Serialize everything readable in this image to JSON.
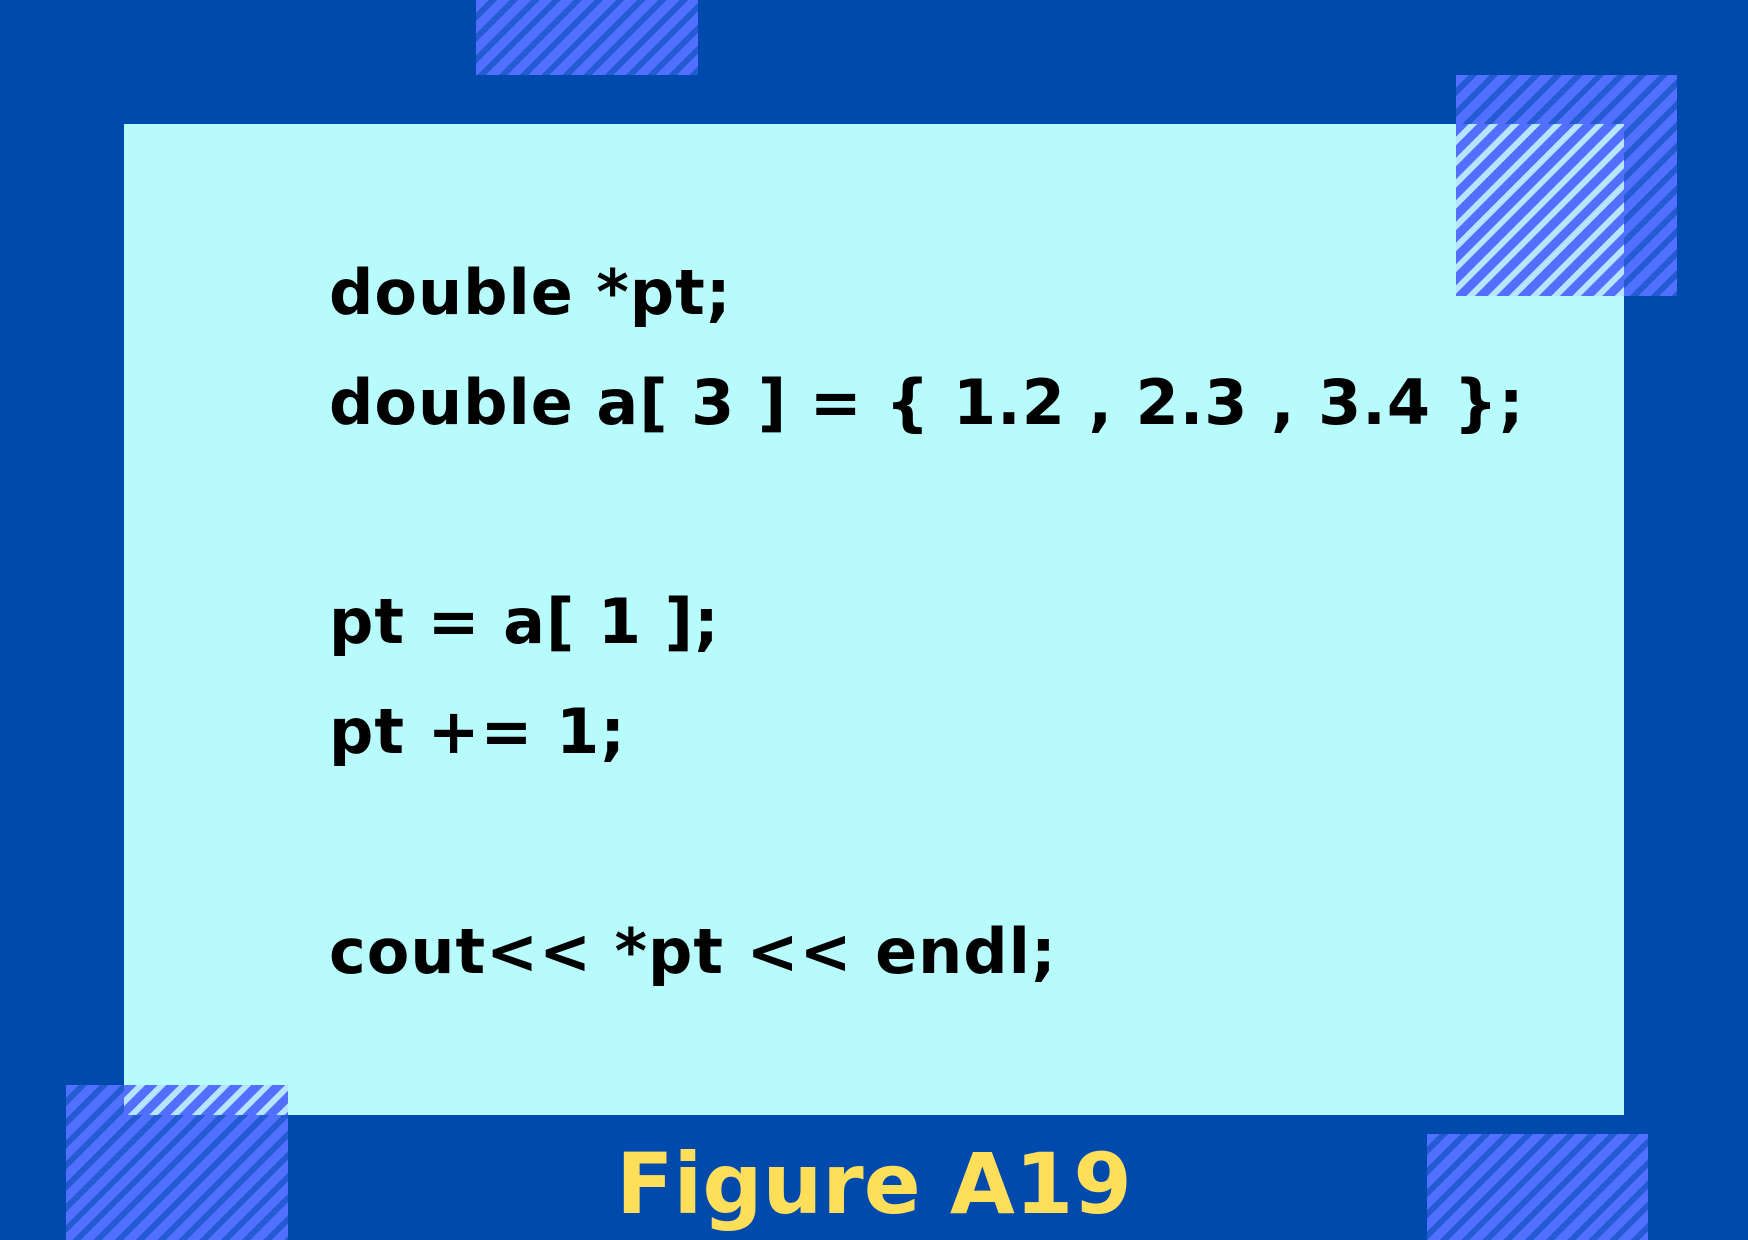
{
  "code": {
    "lines": [
      "double *pt;",
      "double a[ 3 ] = { 1.2 , 2.3 , 3.4 };",
      "pt = a[ 1 ];",
      "pt += 1;",
      "cout<< *pt << endl;"
    ]
  },
  "caption": {
    "text": "Figure A19"
  },
  "colors": {
    "background": "#004aad",
    "panel": "#b8fbfd",
    "stripe": "#5170ff",
    "caption": "#ffde59",
    "code_text": "#000000"
  }
}
